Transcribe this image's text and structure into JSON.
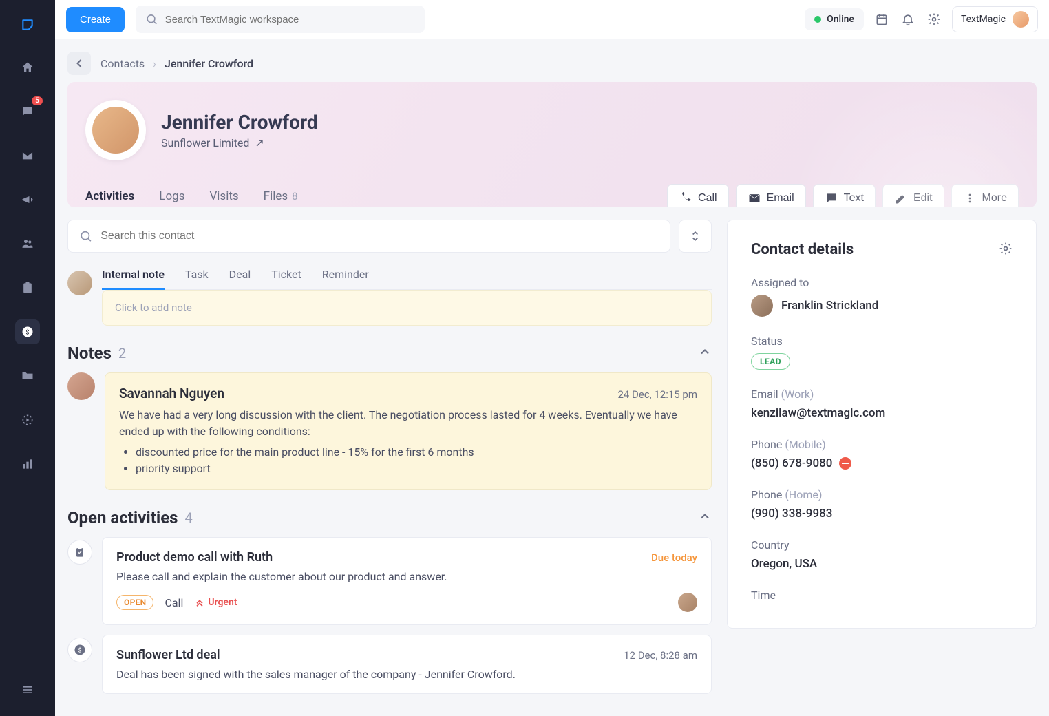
{
  "topbar": {
    "create": "Create",
    "search_placeholder": "Search TextMagic workspace",
    "online": "Online",
    "user": "TextMagic"
  },
  "rail": {
    "badge_count": "5"
  },
  "breadcrumb": {
    "root": "Contacts",
    "current": "Jennifer Crowford"
  },
  "hero": {
    "name": "Jennifer Crowford",
    "company": "Sunflower Limited",
    "tabs": {
      "activities": "Activities",
      "logs": "Logs",
      "visits": "Visits",
      "files": "Files",
      "files_count": "8"
    },
    "actions": {
      "call": "Call",
      "email": "Email",
      "text": "Text",
      "edit": "Edit",
      "more": "More"
    }
  },
  "contact_search_placeholder": "Search this contact",
  "quick": {
    "tabs": {
      "internal_note": "Internal note",
      "task": "Task",
      "deal": "Deal",
      "ticket": "Ticket",
      "reminder": "Reminder"
    },
    "note_placeholder": "Click to add note"
  },
  "notes": {
    "title": "Notes",
    "count": "2",
    "items": [
      {
        "author": "Savannah Nguyen",
        "time": "24 Dec, 12:15 pm",
        "text_intro": "We have had a very long discussion with the client. The negotiation process lasted for 4 weeks. Eventually we have ended up with the following conditions:",
        "bullets": [
          "discounted price for the main product line - 15% for the first 6 months",
          "priority support"
        ]
      }
    ]
  },
  "open_activities": {
    "title": "Open activities",
    "count": "4",
    "items": [
      {
        "title": "Product demo call with Ruth",
        "due": "Due today",
        "desc": "Please call and explain the customer about our product and answer.",
        "status": "OPEN",
        "type": "Call",
        "priority": "Urgent"
      },
      {
        "title": "Sunflower Ltd deal",
        "time": "12 Dec, 8:28 am",
        "desc": "Deal has been signed with the sales manager of the company - Jennifer Crowford."
      }
    ]
  },
  "details": {
    "title": "Contact details",
    "assigned_label": "Assigned to",
    "assigned_value": "Franklin Strickland",
    "status_label": "Status",
    "status_value": "LEAD",
    "email_label": "Email",
    "email_type": "(Work)",
    "email_value": "kenzilaw@textmagic.com",
    "phone1_label": "Phone",
    "phone1_type": "(Mobile)",
    "phone1_value": "(850) 678-9080",
    "phone2_label": "Phone",
    "phone2_type": "(Home)",
    "phone2_value": "(990) 338-9983",
    "country_label": "Country",
    "country_value": "Oregon, USA",
    "time_label": "Time"
  }
}
